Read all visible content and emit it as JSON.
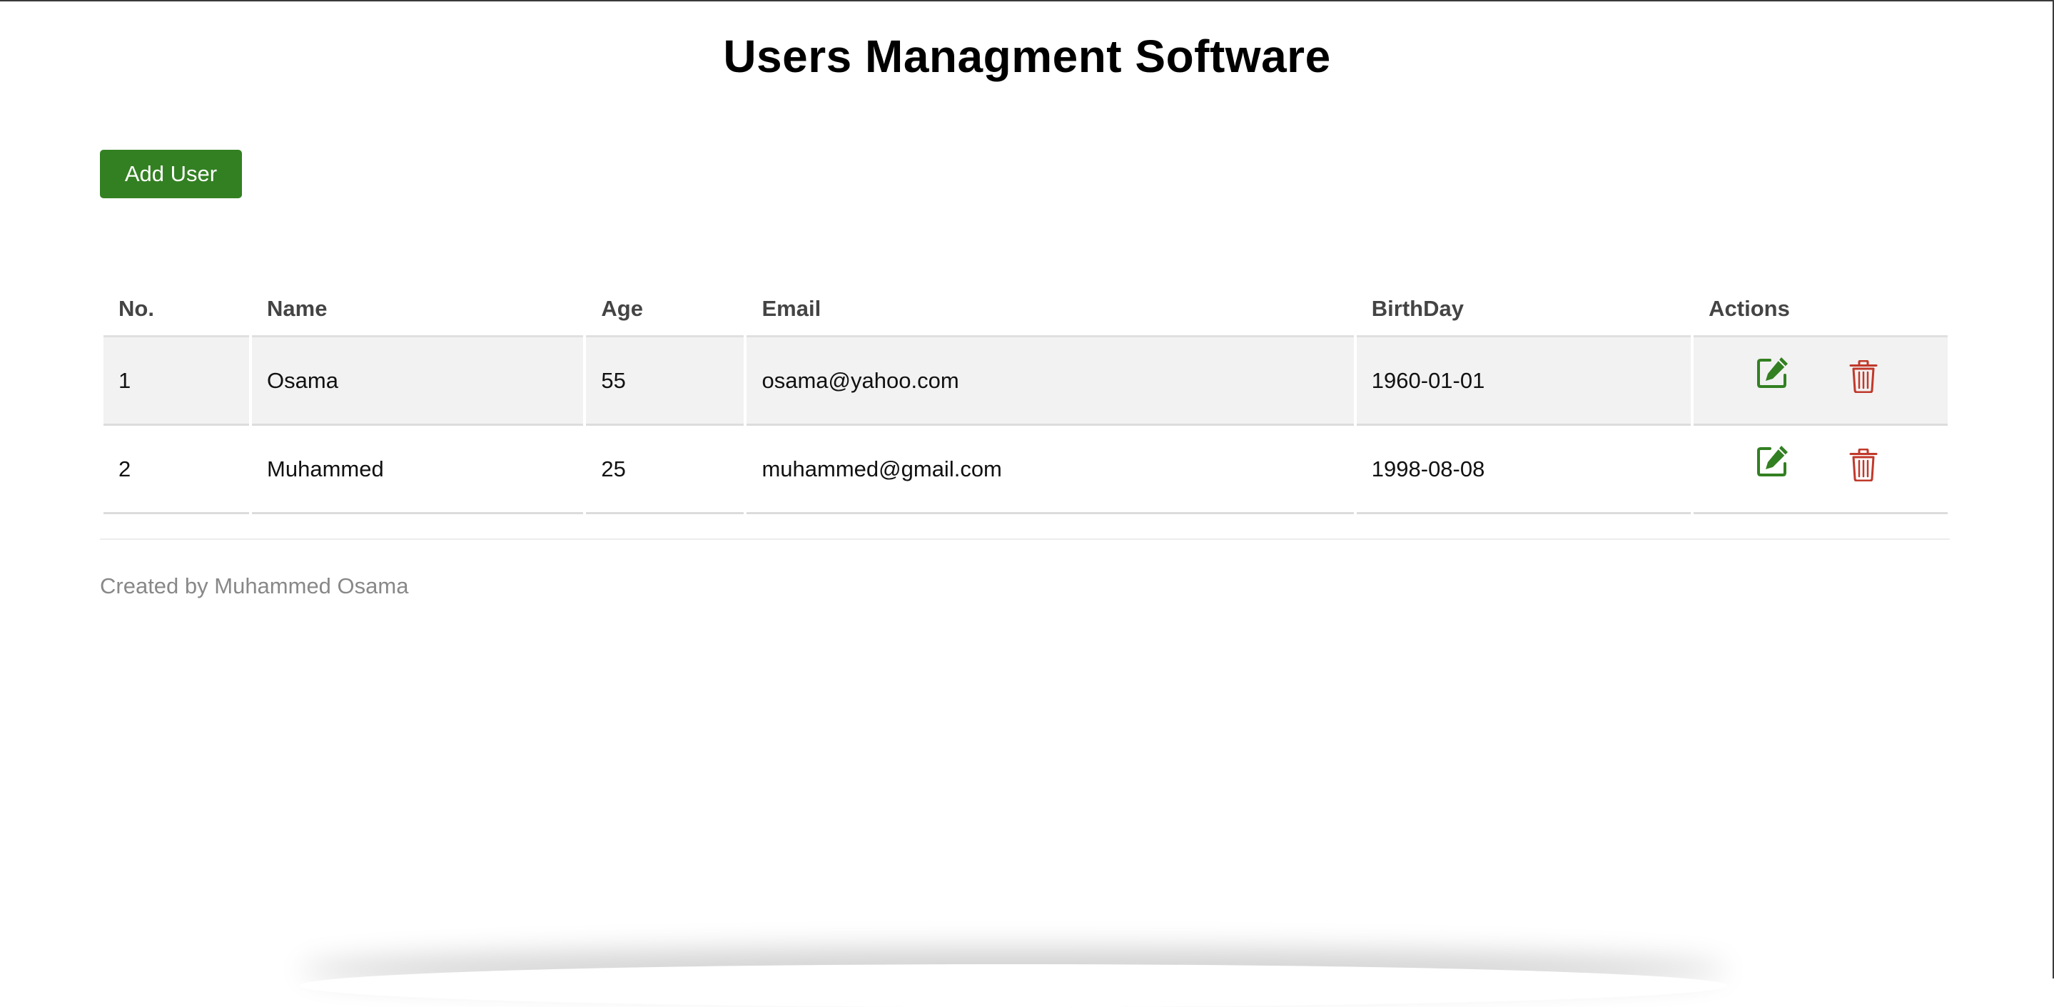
{
  "header": {
    "title": "Users Managment Software"
  },
  "toolbar": {
    "add_user_label": "Add User"
  },
  "table": {
    "columns": [
      "No.",
      "Name",
      "Age",
      "Email",
      "BirthDay",
      "Actions"
    ],
    "rows": [
      {
        "no": "1",
        "name": "Osama",
        "age": "55",
        "email": "osama@yahoo.com",
        "birthday": "1960-01-01"
      },
      {
        "no": "2",
        "name": "Muhammed",
        "age": "25",
        "email": "muhammed@gmail.com",
        "birthday": "1998-08-08"
      }
    ],
    "row_actions": [
      "edit-icon",
      "trash-icon"
    ]
  },
  "footer": {
    "credit": "Created by Muhammed Osama"
  },
  "colors": {
    "accent_green": "#338022",
    "delete_red": "#c0392b",
    "stripe": "#f2f2f2"
  }
}
